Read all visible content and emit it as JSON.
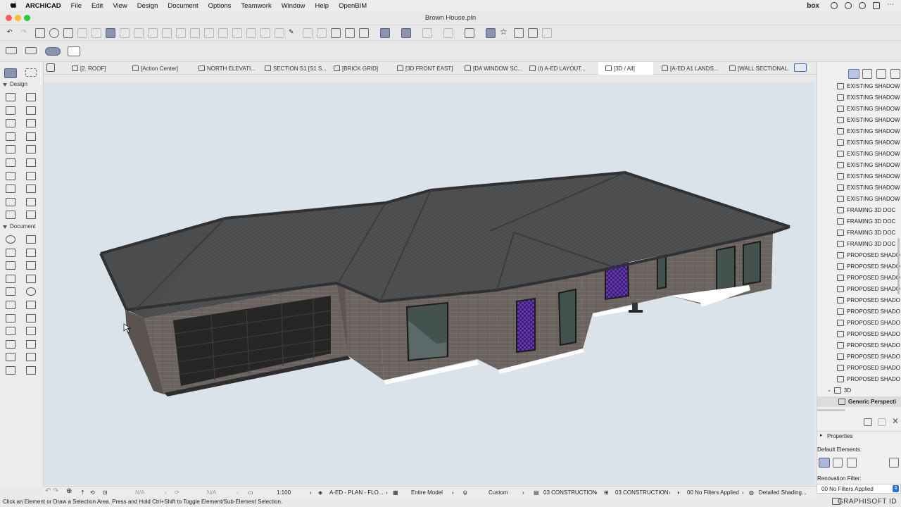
{
  "menubar": {
    "app": "ARCHICAD",
    "items": [
      "File",
      "Edit",
      "View",
      "Design",
      "Document",
      "Options",
      "Teamwork",
      "Window",
      "Help",
      "OpenBIM"
    ],
    "right_brand": "box"
  },
  "window": {
    "title": "Brown House.pln"
  },
  "toolbox": {
    "design_header": "Design",
    "document_header": "Document"
  },
  "view_tabs": [
    {
      "label": "[2. ROOF]"
    },
    {
      "label": "[Action Center]"
    },
    {
      "label": "NORTH ELEVATI..."
    },
    {
      "label": "SECTION S1 [S1 S..."
    },
    {
      "label": "[BRICK GRID]"
    },
    {
      "label": "[3D FRONT EAST]"
    },
    {
      "label": "[DA WINDOW SC..."
    },
    {
      "label": "(I) A-ED LAYOUT..."
    },
    {
      "label": "[3D / All]",
      "active": true
    },
    {
      "label": "[A-ED A1 LANDS..."
    },
    {
      "label": "[WALL SECTIONAL..."
    }
  ],
  "navigator": {
    "items": [
      "EXISTING SHADOW",
      "EXISTING SHADOW",
      "EXISTING SHADOW",
      "EXISTING SHADOW",
      "EXISTING SHADOW",
      "EXISTING SHADOW",
      "EXISTING SHADOW",
      "EXISTING SHADOW",
      "EXISTING SHADOW",
      "EXISTING SHADOW",
      "EXISTING SHADOW",
      "FRAMING 3D DOC",
      "FRAMING 3D DOC",
      "FRAMING 3D DOC",
      "FRAMING 3D DOC",
      "PROPOSED SHADO",
      "PROPOSED SHADO",
      "PROPOSED SHADO",
      "PROPOSED SHADO",
      "PROPOSED SHADO",
      "PROPOSED SHADO",
      "PROPOSED SHADO",
      "PROPOSED SHADO",
      "PROPOSED SHADO",
      "PROPOSED SHADO",
      "PROPOSED SHADO",
      "PROPOSED SHADO"
    ],
    "folder": "3D",
    "selected": "Generic Perspecti",
    "properties_label": "Properties",
    "default_elements_label": "Default Elements:",
    "renovation_filter_label": "Renovation Filter:",
    "renovation_filter_value": "00 No Filters Applied"
  },
  "statusbar": {
    "na1": "N/A",
    "na2": "N/A",
    "scale": "1:100",
    "layer_combo": "A-ED - PLAN - FLO...",
    "model_view": "Entire Model",
    "custom": "Custom",
    "construction1": "03 CONSTRUCTION",
    "construction2": "03 CONSTRUCTION",
    "renovation": "00 No Filters Applied",
    "shading": "Detailed Shading..."
  },
  "hint": "Click an Element or Draw a Selection Area. Press and Hold Ctrl+Shift to Toggle Element/Sub-Element Selection.",
  "brand": "GRAPHISOFT ID",
  "colors": {
    "roof": "#4a4c4e",
    "roof_edge": "#2f3133",
    "brick": "#6b6360",
    "garage_door": "#262626",
    "glass": "#43514f",
    "sky": "#dae2ea",
    "accent_selected": "#8a93b0",
    "purple_pattern": "#5b2a9a"
  }
}
